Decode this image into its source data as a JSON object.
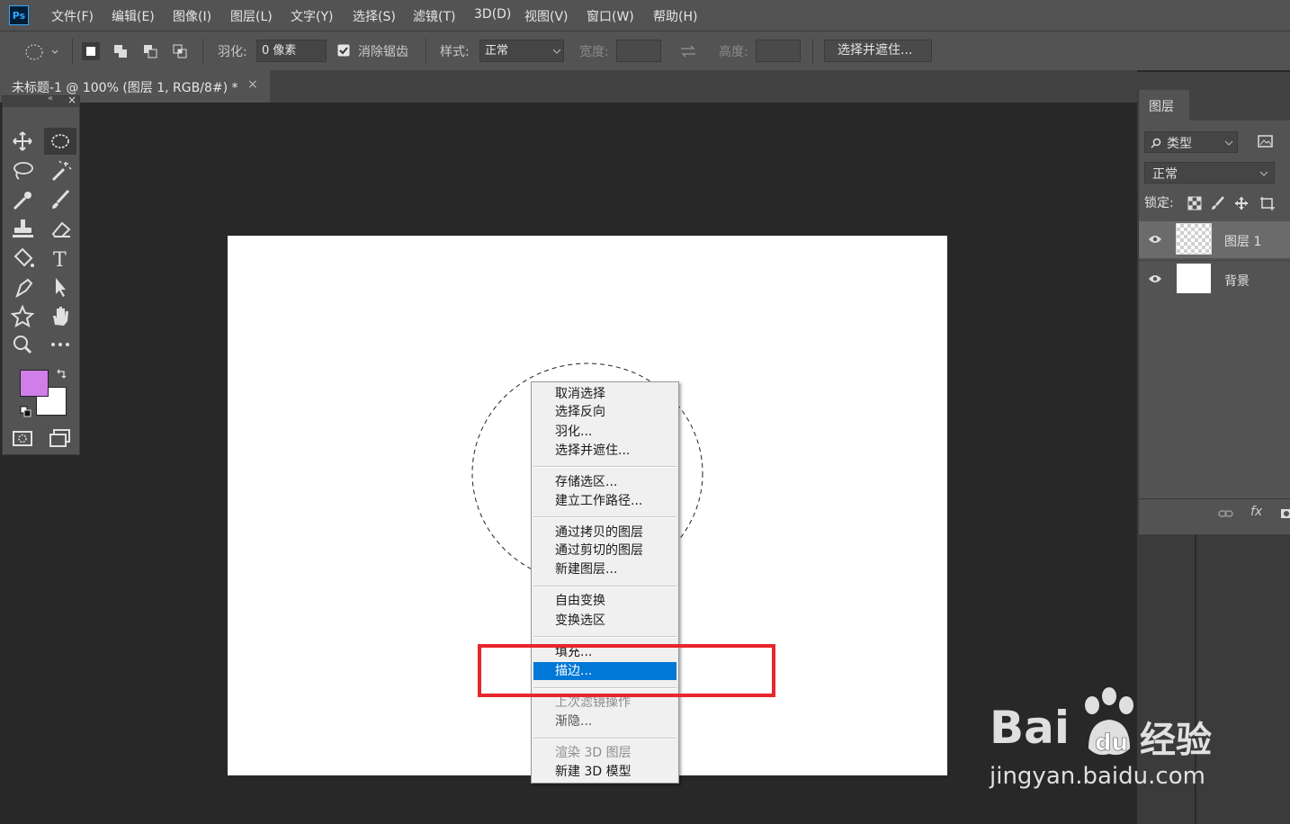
{
  "app": {
    "logo": "Ps"
  },
  "menubar": [
    "文件(F)",
    "编辑(E)",
    "图像(I)",
    "图层(L)",
    "文字(Y)",
    "选择(S)",
    "滤镜(T)",
    "3D(D)",
    "视图(V)",
    "窗口(W)",
    "帮助(H)"
  ],
  "options": {
    "feather_label": "羽化:",
    "feather_value": "0 像素",
    "antialias_label": "消除锯齿",
    "style_label": "样式:",
    "style_value": "正常",
    "width_label": "宽度:",
    "height_label": "高度:",
    "select_mask_button": "选择并遮住..."
  },
  "document": {
    "tab_title": "未标题-1 @ 100% (图层 1, RGB/8#) *",
    "close": "×"
  },
  "tools": {
    "foreground_color": "#d17ee8",
    "background_color": "#ffffff",
    "panel_close": "×",
    "panel_collapse": "«",
    "icons": [
      "move-icon",
      "elliptical-marquee-icon",
      "lasso-icon",
      "magic-wand-icon",
      "eyedropper-icon",
      "brush-icon",
      "stamp-icon",
      "eraser-icon",
      "paint-bucket-icon",
      "type-icon",
      "pen-icon",
      "path-select-icon",
      "custom-shape-icon",
      "hand-icon",
      "zoom-icon",
      "more-icon"
    ]
  },
  "context_menu": {
    "group1": [
      "取消选择",
      "选择反向",
      "羽化...",
      "选择并遮住..."
    ],
    "group2": [
      "存储选区...",
      "建立工作路径..."
    ],
    "group3": [
      "通过拷贝的图层",
      "通过剪切的图层",
      "新建图层..."
    ],
    "group4": [
      "自由变换",
      "变换选区"
    ],
    "group5": [
      "填充...",
      "描边..."
    ],
    "group6": [
      "上次滤镜操作",
      "渐隐..."
    ],
    "group7": [
      "渲染 3D 图层",
      "新建 3D 模型"
    ],
    "highlighted": "描边...",
    "highlight_color": "#0078d7",
    "annotation_color": "#e8262c"
  },
  "layers_panel": {
    "tab": "图层",
    "filter_label": "类型",
    "blend_mode": "正常",
    "lock_label": "锁定:",
    "layers": [
      {
        "name": "图层 1"
      },
      {
        "name": "背景"
      }
    ],
    "footer_fx": "fx"
  },
  "watermark": {
    "brand": "Bai",
    "brand_cn": "经验",
    "url": "jingyan.baidu.com"
  }
}
